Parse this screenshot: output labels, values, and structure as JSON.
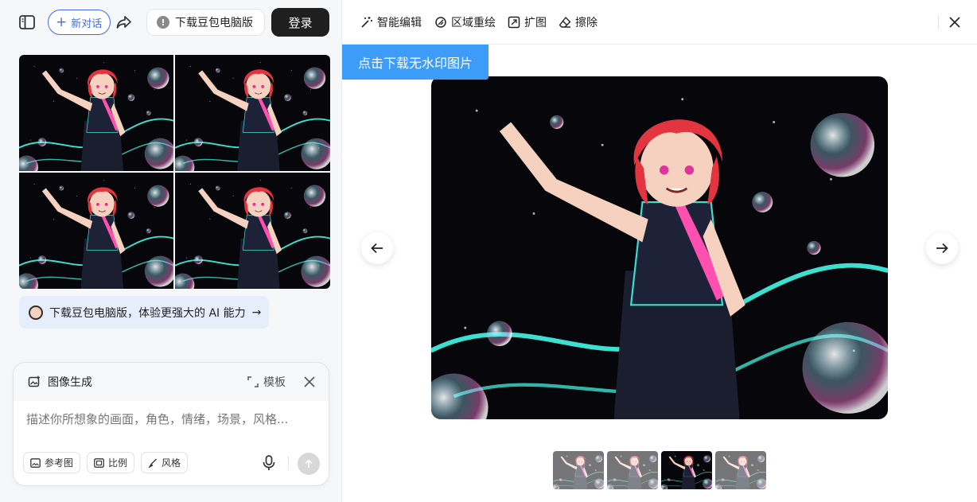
{
  "header": {
    "new_chat_label": "新对话",
    "download_pc_label": "下载豆包电脑版",
    "login_label": "登录"
  },
  "promo": {
    "text": "下载豆包电脑版，体验更强大的 AI 能力",
    "arrow": "→"
  },
  "composer": {
    "title": "图像生成",
    "template_label": "模板",
    "placeholder": "描述你所想象的画面，角色，情绪，场景，风格...",
    "chips": [
      "参考图",
      "比例",
      "风格"
    ]
  },
  "toolbar": {
    "tools": [
      "智能编辑",
      "区域重绘",
      "扩图",
      "擦除"
    ]
  },
  "viewer": {
    "download_no_watermark": "点击下载无水印图片",
    "active_index": 3,
    "thumbnail_count": 4
  },
  "icons": {
    "sidebar": "sidebar-toggle-icon",
    "share": "share-icon",
    "mic": "microphone-icon",
    "send": "send-arrow-icon",
    "close": "close-icon"
  },
  "colors": {
    "accent": "#3e6bf5",
    "download_banner": "#3d9cf7",
    "login_bg": "#1f1f1f",
    "promo_bg": "#e6edfb"
  }
}
